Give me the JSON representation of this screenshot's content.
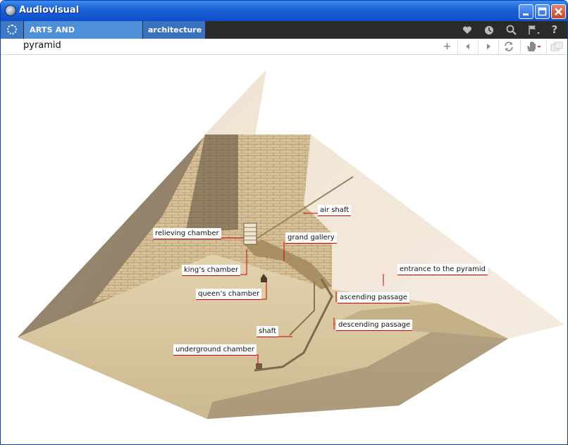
{
  "window": {
    "title": "Audiovisual",
    "minimize_icon": "minimize-icon",
    "maximize_icon": "maximize-icon",
    "close_icon": "close-icon"
  },
  "menu": {
    "section": "ARTS AND ARCHITECTURE",
    "subsection": "architecture",
    "icons": [
      "heart-icon",
      "clock-icon",
      "search-icon",
      "flag-icon",
      "help-icon"
    ],
    "help_glyph": "?"
  },
  "toolbar": {
    "topic": "pyramid",
    "add_glyph": "+",
    "buttons": [
      "add-icon",
      "back-icon",
      "forward-icon",
      "refresh-icon",
      "hand-icon",
      "window-icon"
    ]
  },
  "labels": {
    "air_shaft": "air shaft",
    "relieving_chamber": "relieving chamber",
    "grand_gallery": "grand gallery",
    "kings_chamber": "king’s chamber",
    "entrance": "entrance to the pyramid",
    "queens_chamber": "queen’s chamber",
    "ascending_passage": "ascending passage",
    "descending_passage": "descending passage",
    "shaft": "shaft",
    "underground_chamber": "underground chamber"
  },
  "colors": {
    "accent": "#cc0000",
    "titlebar": "#1e63d8",
    "menubar": "#2b2b2b",
    "menu_tab": "#4f8ed8"
  }
}
